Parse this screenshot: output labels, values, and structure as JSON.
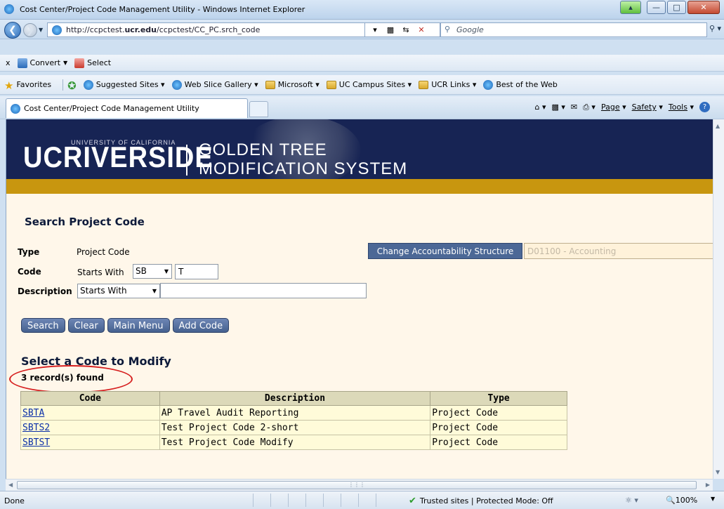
{
  "window": {
    "title": "Cost Center/Project Code Management Utility - Windows Internet Explorer"
  },
  "address_bar": {
    "url_prefix": "http://ccpctest.",
    "url_host": "ucr.edu",
    "url_path": "/ccpctest/CC_PC.srch_code",
    "search_placeholder": "Google"
  },
  "toolbar": {
    "close_label": "x",
    "convert_label": "Convert",
    "select_label": "Select"
  },
  "favorites_bar": {
    "favorites_label": "Favorites",
    "items": [
      {
        "label": "Suggested Sites ▾"
      },
      {
        "label": "Web Slice Gallery ▾"
      },
      {
        "label": "Microsoft ▾"
      },
      {
        "label": "UC Campus Sites ▾"
      },
      {
        "label": "UCR Links ▾"
      },
      {
        "label": "Best of the Web"
      }
    ]
  },
  "tab": {
    "label": "Cost Center/Project Code Management Utility"
  },
  "command_bar": {
    "page_label": "Page",
    "safety_label": "Safety",
    "tools_label": "Tools"
  },
  "banner": {
    "uc_text": "UCRIVERSIDE",
    "uc_sub": "UNIVERSITY OF CALIFORNIA",
    "system_line1": "GOLDEN TREE",
    "system_line2": "MODIFICATION SYSTEM"
  },
  "search_form": {
    "title": "Search Project Code",
    "type_label": "Type",
    "type_value": "Project Code",
    "code_label": "Code",
    "code_starts_with": "Starts With",
    "code_prefix": "SB",
    "code_value": "T",
    "description_label": "Description",
    "description_operator": "Starts With",
    "description_value": "",
    "change_button": "Change Accountability Structure",
    "accountability_value": "D01100 - Accounting"
  },
  "buttons": {
    "search": "Search",
    "clear": "Clear",
    "main_menu": "Main Menu",
    "add_code": "Add Code"
  },
  "results": {
    "title": "Select a Code to Modify",
    "count_text": "3 record(s) found",
    "columns": [
      "Code",
      "Description",
      "Type"
    ],
    "rows": [
      {
        "code": "SBTA",
        "description": "AP Travel Audit Reporting",
        "type": "Project Code"
      },
      {
        "code": "SBTS2",
        "description": "Test Project Code 2-short",
        "type": "Project Code"
      },
      {
        "code": "SBTST",
        "description": "Test Project Code Modify",
        "type": "Project Code"
      }
    ]
  },
  "status_bar": {
    "status": "Done",
    "zone": "Trusted sites | Protected Mode: Off",
    "zoom": "100%"
  },
  "colors": {
    "banner_navy": "#172454",
    "banner_gold": "#c8960f",
    "page_background": "#fff7ea",
    "highlight_ring": "#d61f1f"
  }
}
